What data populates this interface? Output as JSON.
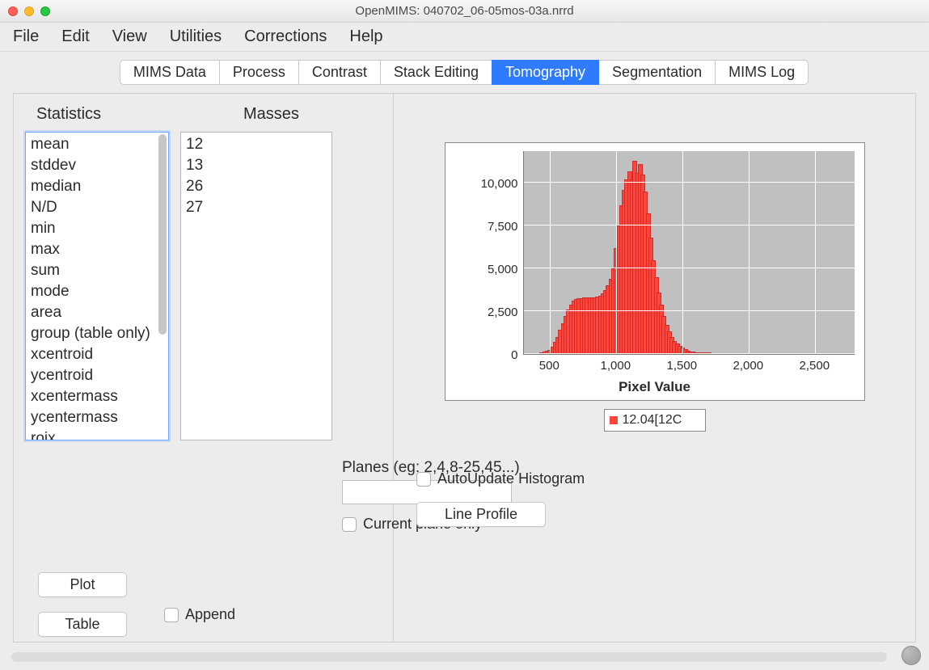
{
  "window": {
    "title": "OpenMIMS: 040702_06-05mos-03a.nrrd"
  },
  "menu": {
    "items": [
      "File",
      "Edit",
      "View",
      "Utilities",
      "Corrections",
      "Help"
    ]
  },
  "tabs": {
    "items": [
      "MIMS Data",
      "Process",
      "Contrast",
      "Stack Editing",
      "Tomography",
      "Segmentation",
      "MIMS Log"
    ],
    "active_index": 4
  },
  "left": {
    "stats_header": "Statistics",
    "masses_header": "Masses",
    "stats_items": [
      "mean",
      "stddev",
      "median",
      "N/D",
      "min",
      "max",
      "sum",
      "mode",
      "area",
      "group (table only)",
      "xcentroid",
      "ycentroid",
      "xcentermass",
      "ycentermass",
      "roix"
    ],
    "masses_items": [
      "12",
      "13",
      "26",
      "27"
    ],
    "planes_label": "Planes (eg: 2,4,8-25,45...)",
    "planes_value": "",
    "current_plane_label": "Current plane only",
    "plot_label": "Plot",
    "table_label": "Table",
    "append_label": "Append"
  },
  "right": {
    "autoupdate_label": "AutoUpdate Histogram",
    "lineprofile_label": "Line Profile",
    "legend": "12.04[12C"
  },
  "chart_data": {
    "type": "bar",
    "title": "",
    "xlabel": "Pixel Value",
    "ylabel": "",
    "xlim": [
      300,
      2800
    ],
    "ylim": [
      0,
      12000
    ],
    "x_ticks": [
      500,
      1000,
      1500,
      2000,
      2500
    ],
    "y_ticks": [
      0,
      2500,
      5000,
      7500,
      10000
    ],
    "series": [
      {
        "name": "12.04[12C",
        "color": "#ff453a",
        "x": [
          440,
          460,
          480,
          500,
          520,
          540,
          560,
          580,
          600,
          620,
          640,
          660,
          680,
          700,
          720,
          740,
          760,
          780,
          800,
          820,
          840,
          860,
          880,
          900,
          920,
          940,
          960,
          980,
          1000,
          1020,
          1040,
          1060,
          1080,
          1100,
          1120,
          1140,
          1160,
          1180,
          1200,
          1220,
          1240,
          1260,
          1280,
          1300,
          1320,
          1340,
          1360,
          1380,
          1400,
          1420,
          1440,
          1460,
          1480,
          1500,
          1520,
          1540,
          1560,
          1580,
          1600,
          1620,
          1640,
          1660,
          1680,
          1700
        ],
        "y": [
          80,
          120,
          180,
          260,
          420,
          700,
          1000,
          1400,
          1800,
          2200,
          2600,
          2900,
          3100,
          3200,
          3250,
          3280,
          3300,
          3300,
          3320,
          3320,
          3320,
          3350,
          3420,
          3550,
          3750,
          4000,
          4400,
          5000,
          6200,
          7500,
          8700,
          9600,
          10200,
          10700,
          10200,
          11300,
          10600,
          11100,
          10500,
          9500,
          8200,
          6800,
          5500,
          4500,
          3600,
          2900,
          2200,
          1700,
          1300,
          1000,
          780,
          600,
          470,
          360,
          270,
          210,
          160,
          130,
          100,
          80,
          60,
          45,
          30,
          20
        ]
      }
    ]
  }
}
